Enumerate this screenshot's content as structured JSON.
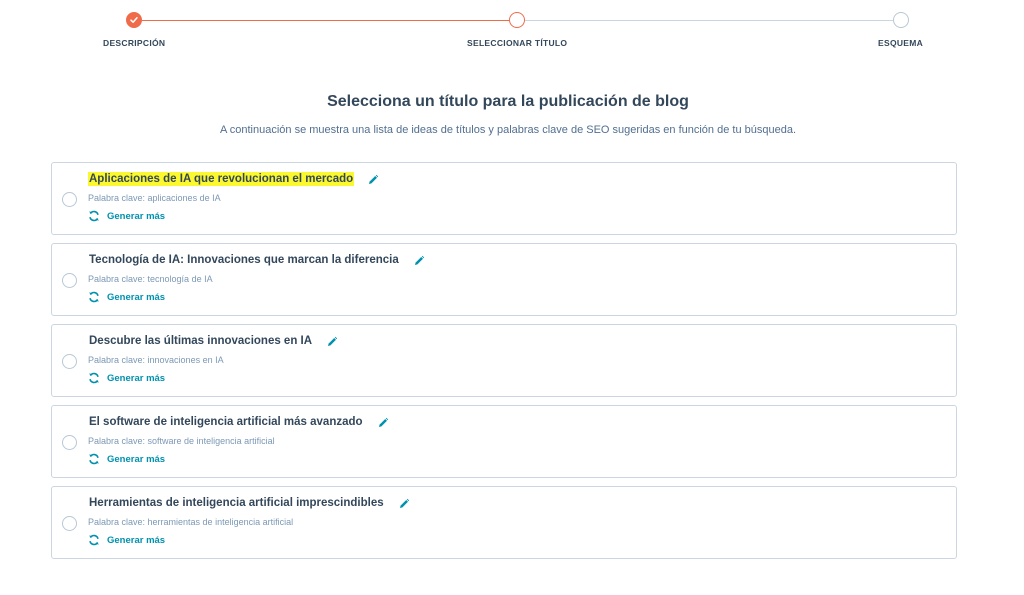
{
  "stepper": {
    "steps": [
      {
        "label": "DESCRIPCIÓN",
        "state": "done"
      },
      {
        "label": "SELECCIONAR TÍTULO",
        "state": "active"
      },
      {
        "label": "ESQUEMA",
        "state": "todo"
      }
    ]
  },
  "main": {
    "heading": "Selecciona un título para la publicación de blog",
    "subheading": "A continuación se muestra una lista de ideas de títulos y palabras clave de SEO sugeridas en función de tu búsqueda."
  },
  "titles": [
    {
      "title": "Aplicaciones de IA que revolucionan el mercado",
      "keyword": "Palabra clave: aplicaciones de IA",
      "generate_label": "Generar más",
      "highlighted": true
    },
    {
      "title": "Tecnología de IA: Innovaciones que marcan la diferencia",
      "keyword": "Palabra clave: tecnología de IA",
      "generate_label": "Generar más"
    },
    {
      "title": "Descubre las últimas innovaciones en IA",
      "keyword": "Palabra clave: innovaciones en IA",
      "generate_label": "Generar más"
    },
    {
      "title": "El software de inteligencia artificial más avanzado",
      "keyword": "Palabra clave: software de inteligencia artificial",
      "generate_label": "Generar más"
    },
    {
      "title": "Herramientas de inteligencia artificial imprescindibles",
      "keyword": "Palabra clave: herramientas de inteligencia artificial",
      "generate_label": "Generar más"
    }
  ],
  "colors": {
    "accent": "#f06b4a",
    "link": "#0091ae",
    "highlight": "#fbf82f",
    "text": "#33475b"
  },
  "icons": {
    "step_done": "check-icon",
    "edit": "pencil-icon",
    "generate": "refresh-icon"
  }
}
